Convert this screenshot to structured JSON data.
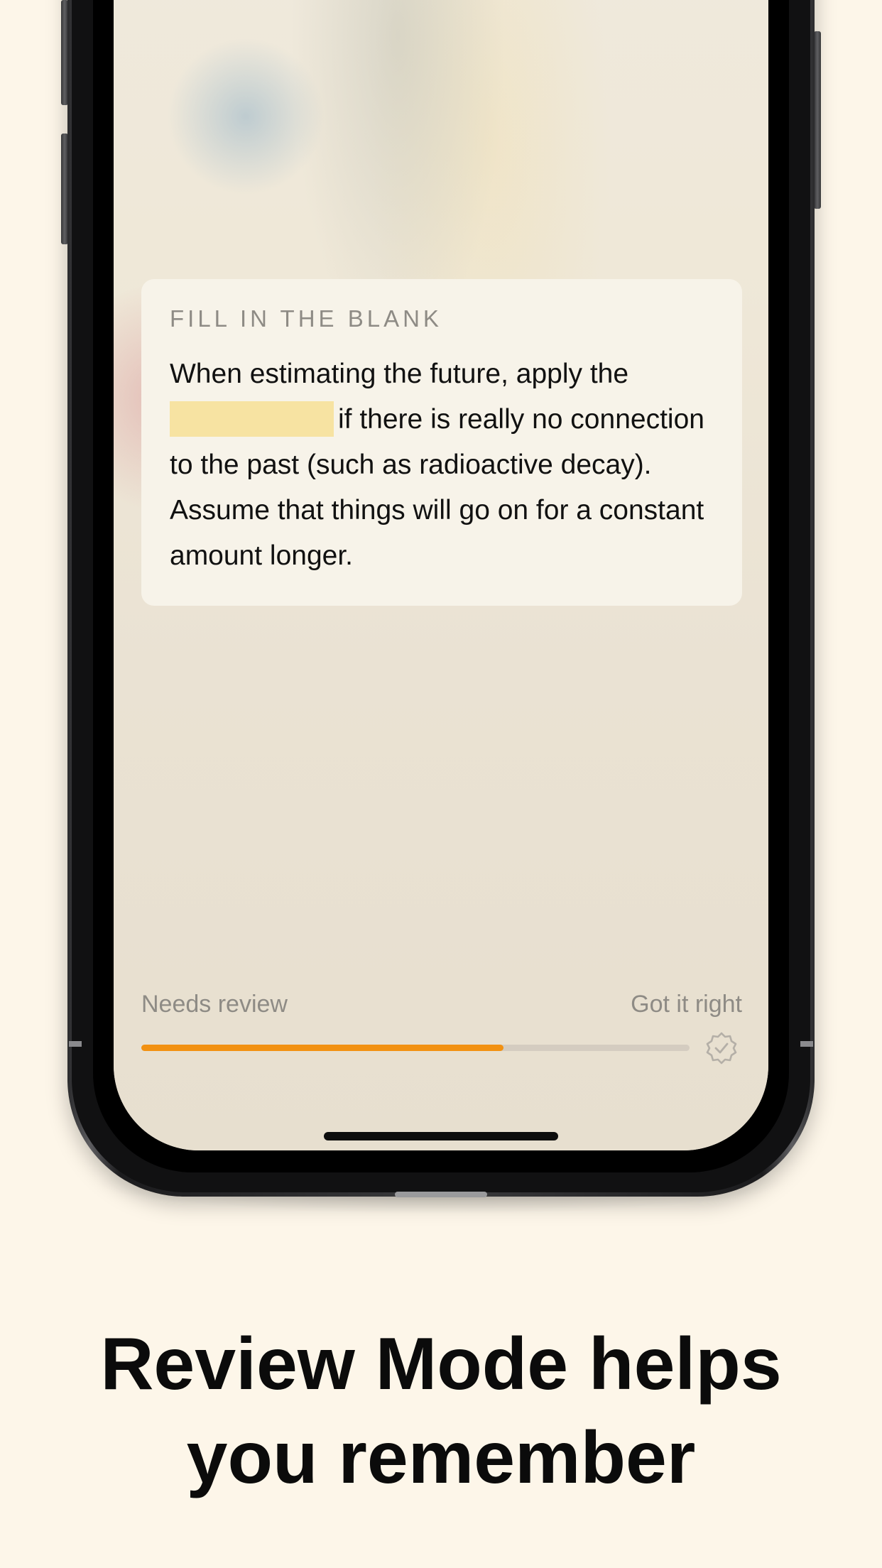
{
  "quiz": {
    "label": "FILL IN THE BLANK",
    "text_before": "When estimating the future, apply the",
    "text_after": "if there is really no connection to the past (such as radioactive decay). Assume that things will go on for a constant amount longer."
  },
  "review": {
    "left_label": "Needs review",
    "right_label": "Got it right",
    "progress_fraction": 0.66,
    "accent_color": "#f29111",
    "icon": "check-badge-icon"
  },
  "caption": {
    "line1": "Review Mode helps",
    "line2": "you remember"
  }
}
